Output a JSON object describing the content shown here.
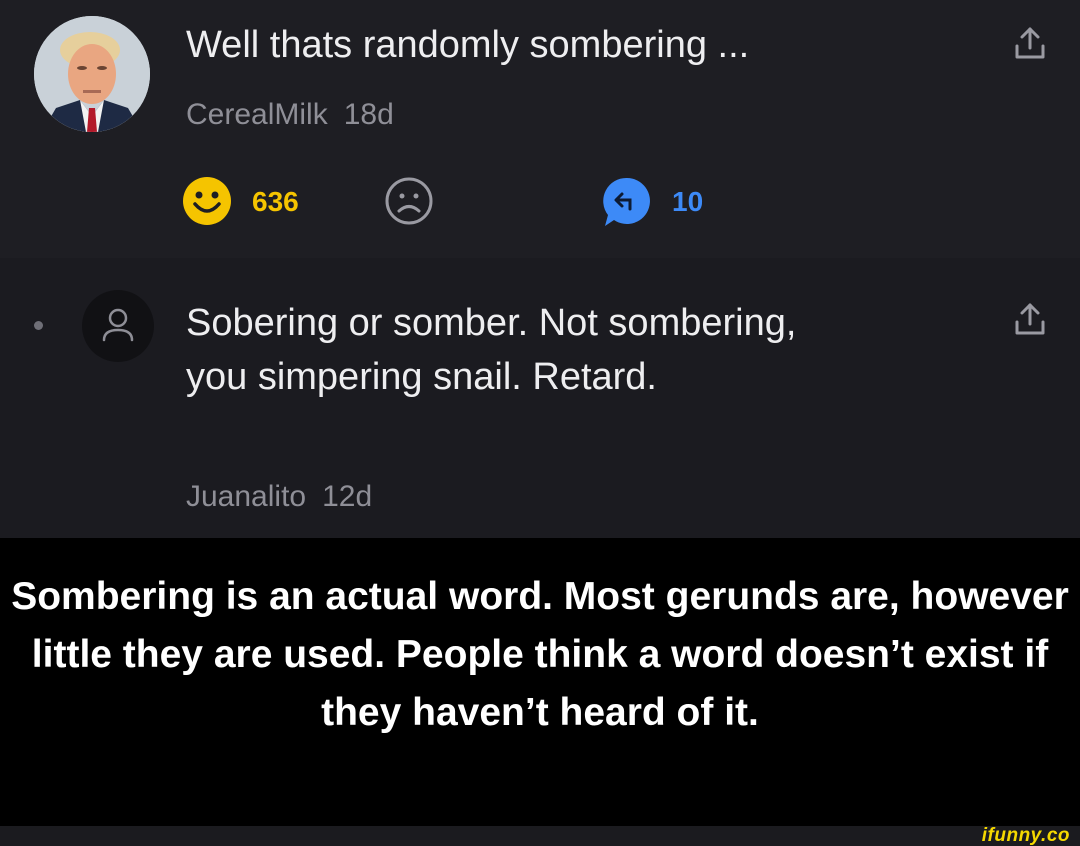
{
  "comment1": {
    "text": "Well thats randomly sombering ...",
    "username": "CerealMilk",
    "time": "18d",
    "likes": "636",
    "replies": "10"
  },
  "comment2": {
    "text": "Sobering or somber. Not sombering, you simpering snail. Retard.",
    "username": "Juanalito",
    "time": "12d"
  },
  "caption": "Sombering is an actual word. Most gerunds are, however little they are used. People think a word doesn’t exist if they haven’t heard of it.",
  "watermark": "ifunny.co",
  "colors": {
    "like": "#f5c400",
    "reply": "#3d8af7",
    "watermark": "#f5d800"
  }
}
